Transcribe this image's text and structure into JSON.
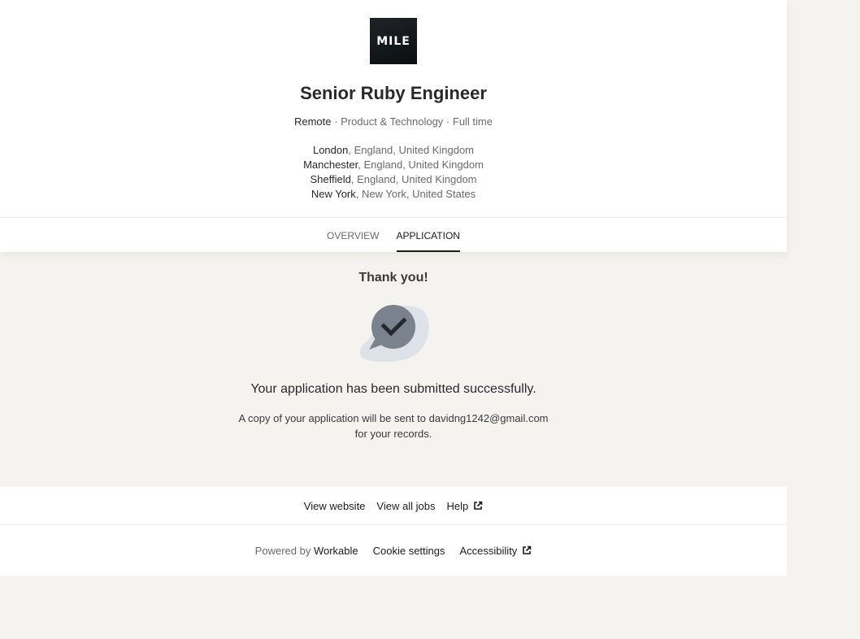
{
  "header": {
    "logo_text": "MILE",
    "job_title": "Senior Ruby Engineer",
    "meta": {
      "workplace": "Remote",
      "separator": " · ",
      "department": "Product & Technology",
      "type": "Full time"
    },
    "locations": [
      {
        "city": "London",
        "rest": ", England, United Kingdom"
      },
      {
        "city": "Manchester",
        "rest": ", England, United Kingdom"
      },
      {
        "city": "Sheffield",
        "rest": ", England, United Kingdom"
      },
      {
        "city": "New York",
        "rest": ", New York, United States"
      }
    ],
    "tabs": [
      {
        "label": "OVERVIEW",
        "active": false
      },
      {
        "label": "APPLICATION",
        "active": true
      }
    ]
  },
  "confirmation": {
    "title": "Thank you!",
    "message": "Your application has been submitted successfully.",
    "copy_line1": "A copy of your application will be sent to davidng1242@gmail.com",
    "copy_line2": "for your records."
  },
  "footer": {
    "links": {
      "view_website": "View website",
      "view_all_jobs": "View all jobs",
      "help": "Help"
    },
    "powered_by": "Powered by ",
    "brand": "Workable",
    "cookie_settings": "Cookie settings",
    "accessibility": "Accessibility"
  },
  "colors": {
    "background": "#f4f3ef",
    "card": "#ffffff",
    "text": "#292929",
    "muted": "#6b6b6b",
    "icon_bubble": "#7a838d",
    "icon_blob": "#dde1e8"
  }
}
